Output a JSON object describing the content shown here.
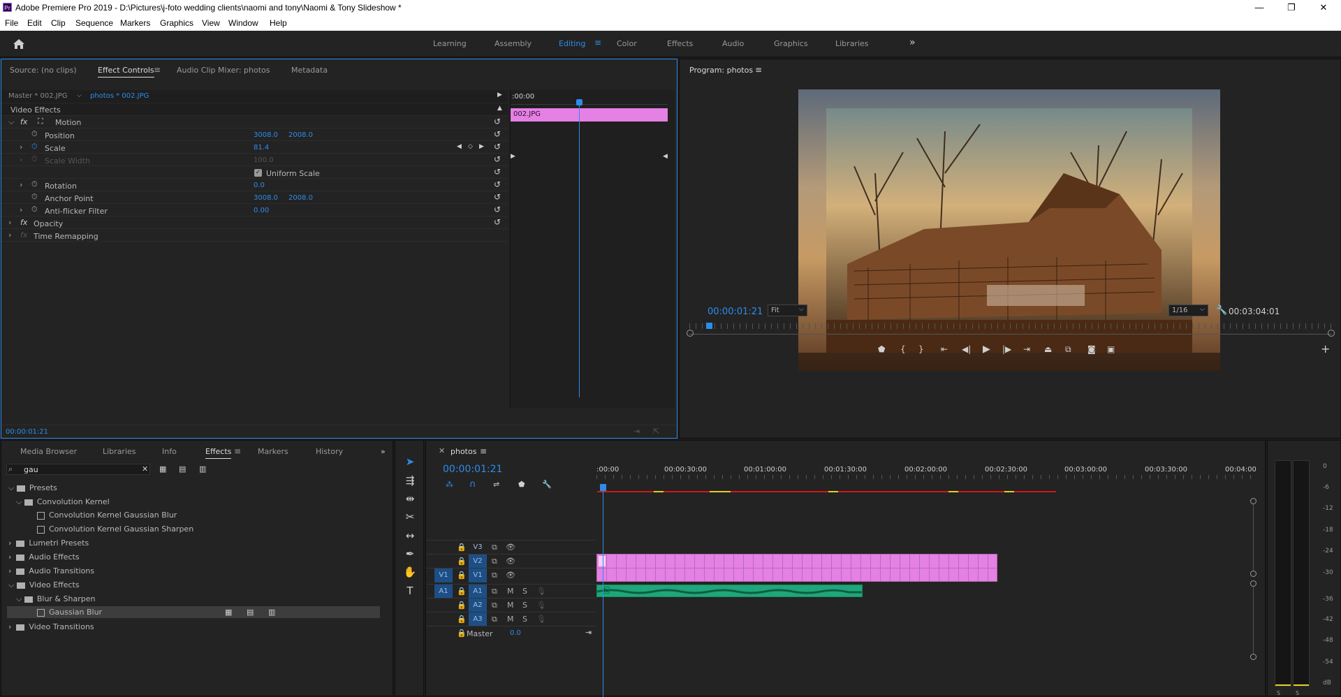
{
  "window": {
    "title": "Adobe Premiere Pro 2019 - D:\\Pictures\\j-foto wedding clients\\naomi and tony\\Naomi & Tony Slideshow *",
    "logo": "Pr",
    "minimize": "—",
    "restore": "❐",
    "close": "✕"
  },
  "menu": [
    "File",
    "Edit",
    "Clip",
    "Sequence",
    "Markers",
    "Graphics",
    "View",
    "Window",
    "Help"
  ],
  "workspaces": {
    "items": [
      "Learning",
      "Assembly",
      "Editing",
      "Color",
      "Effects",
      "Audio",
      "Graphics",
      "Libraries"
    ],
    "active": "Editing",
    "more": "»"
  },
  "source_panel": {
    "tabs": [
      "Source: (no clips)",
      "Effect Controls",
      "Audio Clip Mixer: photos",
      "Metadata"
    ],
    "active_tab": "Effect Controls",
    "master_clip": "Master * 002.JPG",
    "sequence_clip": "photos * 002.JPG",
    "timeline_start": ":00:00",
    "clip_bar_label": "002.JPG",
    "section": "Video Effects",
    "motion": "Motion",
    "properties": [
      {
        "name": "Position",
        "values": [
          "3008.0",
          "2008.0"
        ]
      },
      {
        "name": "Scale",
        "values": [
          "81.4"
        ]
      },
      {
        "name": "Scale Width",
        "values": [
          "100.0"
        ]
      },
      {
        "name": "Uniform Scale",
        "values": []
      },
      {
        "name": "Rotation",
        "values": [
          "0.0"
        ]
      },
      {
        "name": "Anchor Point",
        "values": [
          "3008.0",
          "2008.0"
        ]
      },
      {
        "name": "Anti-flicker Filter",
        "values": [
          "0.00"
        ]
      }
    ],
    "opacity": "Opacity",
    "time_remapping": "Time Remapping",
    "timecode": "00:00:01:21"
  },
  "program_monitor": {
    "title": "Program: photos",
    "timecode": "00:00:01:21",
    "fit": "Fit",
    "resolution": "1/16",
    "duration": "00:03:04:01"
  },
  "effects_panel": {
    "tabs": [
      "Media Browser",
      "Libraries",
      "Info",
      "Effects",
      "Markers",
      "History"
    ],
    "active_tab": "Effects",
    "search_value": "gau",
    "tree": [
      {
        "label": "Presets",
        "level": 0
      },
      {
        "label": "Convolution Kernel",
        "level": 1
      },
      {
        "label": "Convolution Kernel Gaussian Blur",
        "level": 2
      },
      {
        "label": "Convolution Kernel Gaussian Sharpen",
        "level": 2
      },
      {
        "label": "Lumetri Presets",
        "level": 0
      },
      {
        "label": "Audio Effects",
        "level": 0
      },
      {
        "label": "Audio Transitions",
        "level": 0
      },
      {
        "label": "Video Effects",
        "level": 0
      },
      {
        "label": "Blur & Sharpen",
        "level": 1
      },
      {
        "label": "Gaussian Blur",
        "level": 2
      },
      {
        "label": "Video Transitions",
        "level": 0
      }
    ]
  },
  "timeline": {
    "sequence": "photos",
    "timecode": "00:00:01:21",
    "ruler": [
      ":00:00",
      "00:00:30:00",
      "00:01:00:00",
      "00:01:30:00",
      "00:02:00:00",
      "00:02:30:00",
      "00:03:00:00",
      "00:03:30:00",
      "00:04:00"
    ],
    "video_tracks": [
      "V3",
      "V2",
      "V1"
    ],
    "audio_tracks": [
      "A1",
      "A2",
      "A3"
    ],
    "source_patch_video": "V1",
    "source_patch_audio": "A1",
    "mute": "M",
    "solo": "S",
    "master": "Master",
    "master_value": "0.0"
  },
  "audio_meter": {
    "scale": [
      "0",
      "-6",
      "-12",
      "-18",
      "-24",
      "-30",
      "-36",
      "-42",
      "-48",
      "-54",
      "dB"
    ],
    "solo_labels": [
      "S",
      "S"
    ]
  },
  "colors": {
    "accent": "#2d8ceb",
    "clip_video": "#e580e5",
    "clip_audio": "#1fa67a",
    "panel_bg": "#232323"
  }
}
